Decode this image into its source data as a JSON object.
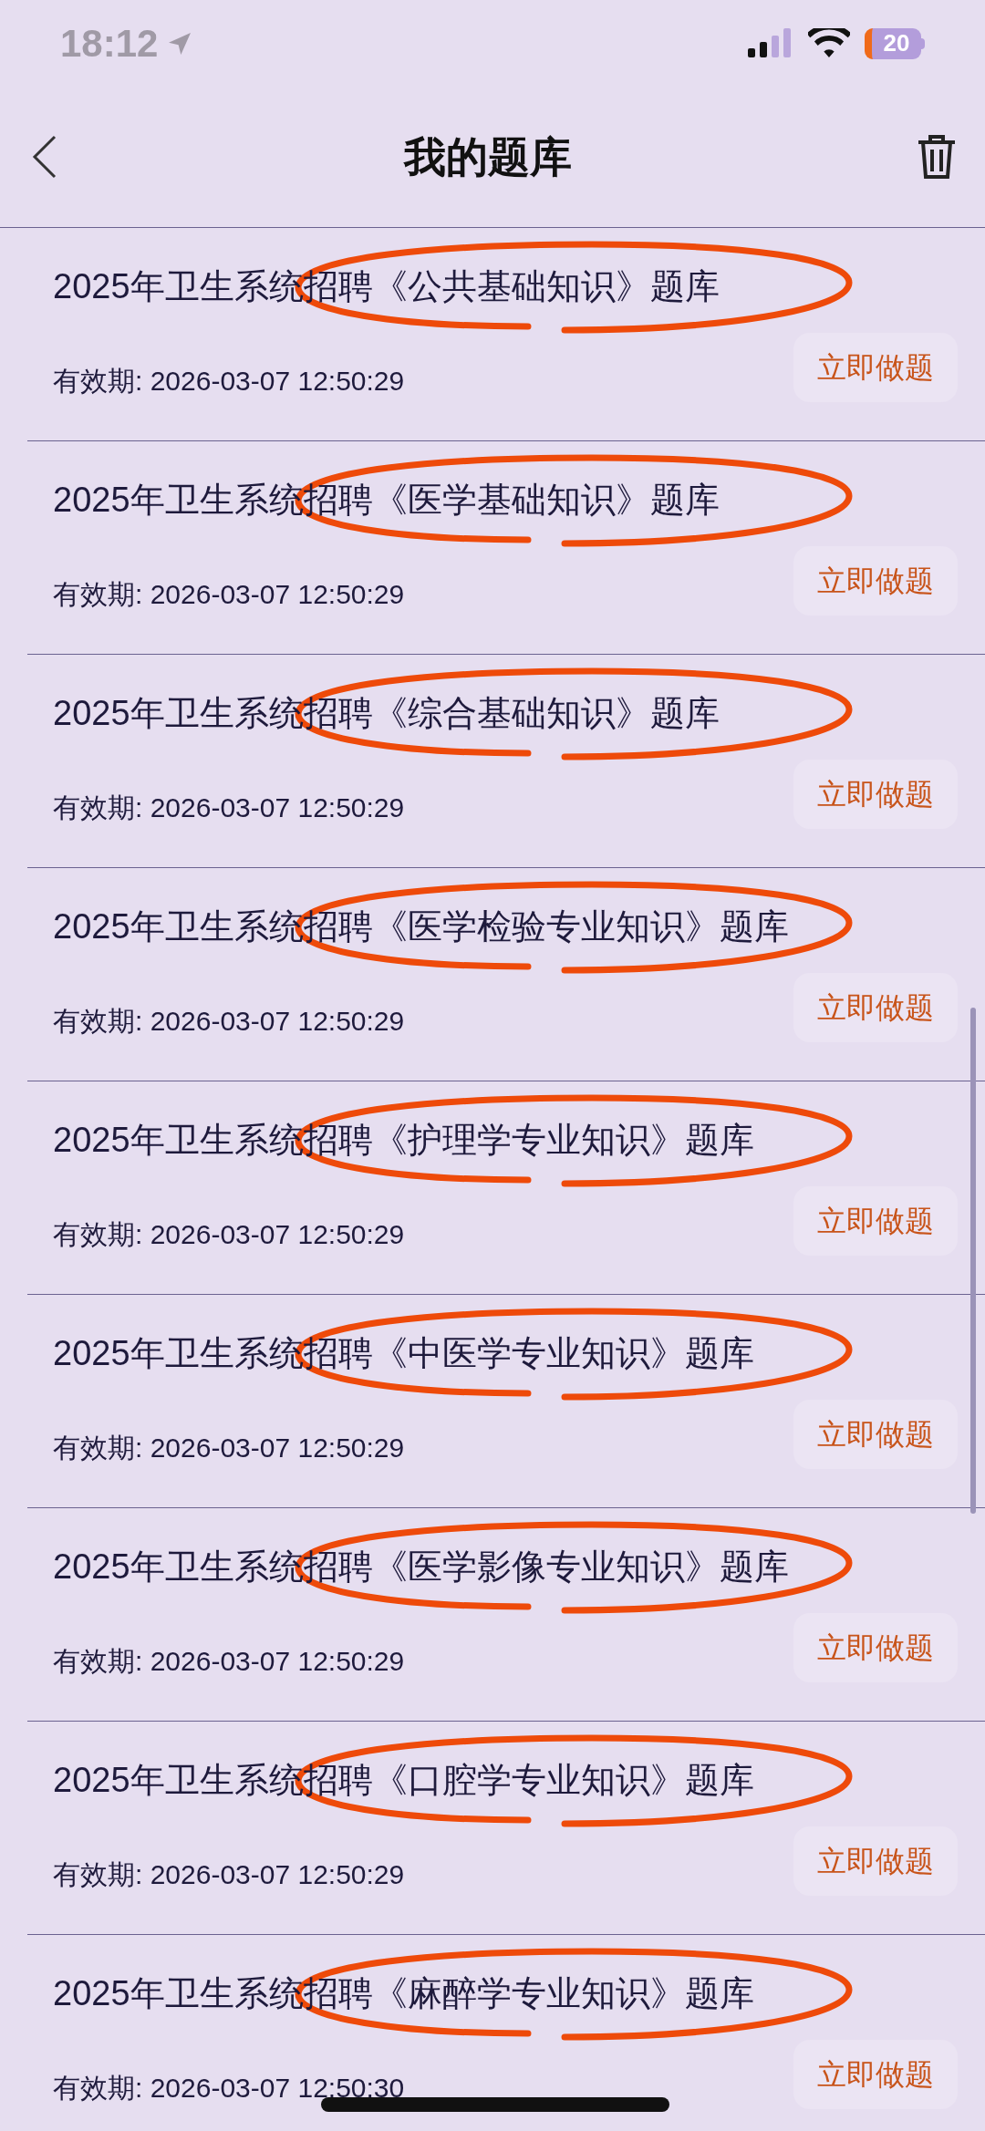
{
  "status_bar": {
    "time": "18:12",
    "battery": "20"
  },
  "nav": {
    "title": "我的题库"
  },
  "items": [
    {
      "title": "2025年卫生系统招聘《公共基础知识》题库",
      "expiry": "有效期: 2026-03-07 12:50:29",
      "action": "立即做题",
      "circled": true
    },
    {
      "title": "2025年卫生系统招聘《医学基础知识》题库",
      "expiry": "有效期: 2026-03-07 12:50:29",
      "action": "立即做题",
      "circled": true
    },
    {
      "title": "2025年卫生系统招聘《综合基础知识》题库",
      "expiry": "有效期: 2026-03-07 12:50:29",
      "action": "立即做题",
      "circled": true
    },
    {
      "title": "2025年卫生系统招聘《医学检验专业知识》题库",
      "expiry": "有效期: 2026-03-07 12:50:29",
      "action": "立即做题",
      "circled": true
    },
    {
      "title": "2025年卫生系统招聘《护理学专业知识》题库",
      "expiry": "有效期: 2026-03-07 12:50:29",
      "action": "立即做题",
      "circled": true
    },
    {
      "title": "2025年卫生系统招聘《中医学专业知识》题库",
      "expiry": "有效期: 2026-03-07 12:50:29",
      "action": "立即做题",
      "circled": true
    },
    {
      "title": "2025年卫生系统招聘《医学影像专业知识》题库",
      "expiry": "有效期: 2026-03-07 12:50:29",
      "action": "立即做题",
      "circled": true
    },
    {
      "title": "2025年卫生系统招聘《口腔学专业知识》题库",
      "expiry": "有效期: 2026-03-07 12:50:29",
      "action": "立即做题",
      "circled": true
    },
    {
      "title": "2025年卫生系统招聘《麻醉学专业知识》题库",
      "expiry": "有效期: 2026-03-07 12:50:30",
      "action": "立即做题",
      "circled": true
    }
  ]
}
